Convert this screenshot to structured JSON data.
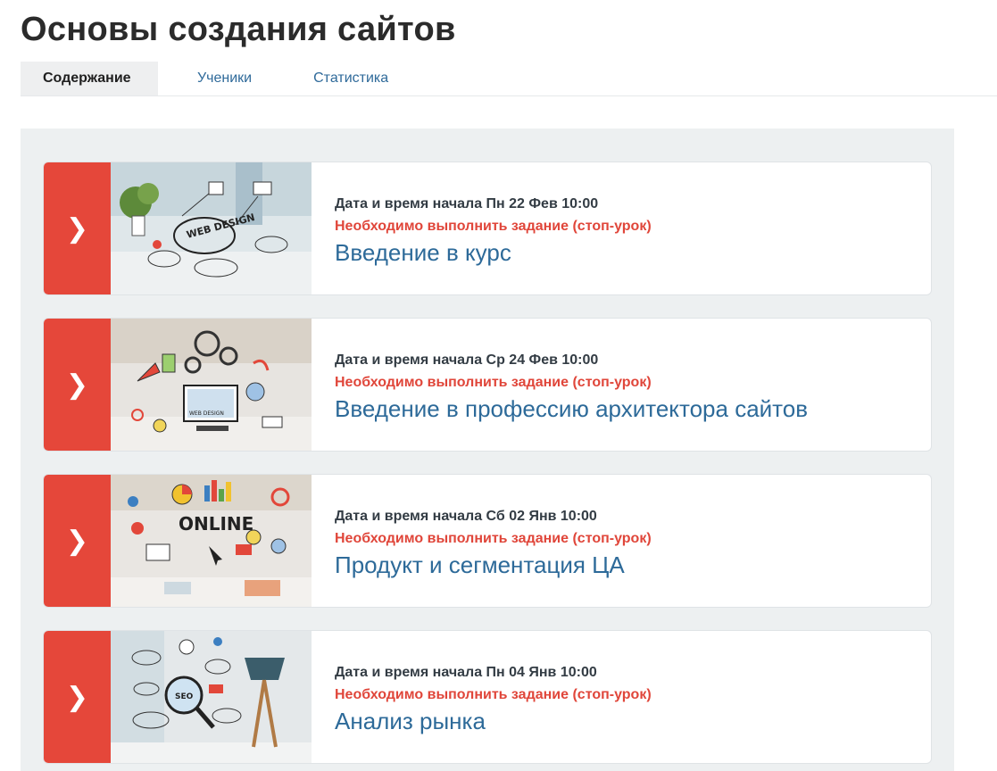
{
  "page": {
    "title": "Основы создания сайтов"
  },
  "tabs": [
    {
      "label": "Содержание",
      "active": true
    },
    {
      "label": "Ученики",
      "active": false
    },
    {
      "label": "Статистика",
      "active": false
    }
  ],
  "lessons": [
    {
      "date": "Дата и время начала Пн 22 Фев 10:00",
      "warning": "Необходимо выполнить задание (стоп-урок)",
      "title": "Введение в курс",
      "thumb_label": "WEB DESIGN",
      "thumb_icon": "web-design-sketch"
    },
    {
      "date": "Дата и время начала Ср 24 Фев 10:00",
      "warning": "Необходимо выполнить задание (стоп-урок)",
      "title": "Введение в профессию архитектора сайтов",
      "thumb_label": "WEB DESIGN",
      "thumb_icon": "computer-gears-sketch"
    },
    {
      "date": "Дата и время начала Сб 02 Янв 10:00",
      "warning": "Необходимо выполнить задание (стоп-урок)",
      "title": "Продукт и сегментация ЦА",
      "thumb_label": "ONLINE",
      "thumb_icon": "online-marketing-sketch"
    },
    {
      "date": "Дата и время начала Пн 04 Янв 10:00",
      "warning": "Необходимо выполнить задание (стоп-урок)",
      "title": "Анализ рынка",
      "thumb_label": "SEO",
      "thumb_icon": "seo-magnifier-sketch"
    }
  ],
  "colors": {
    "accent_red": "#e5473a",
    "warning_red": "#e0463a",
    "link_blue": "#2d6a99",
    "content_bg": "#edf0f1"
  }
}
